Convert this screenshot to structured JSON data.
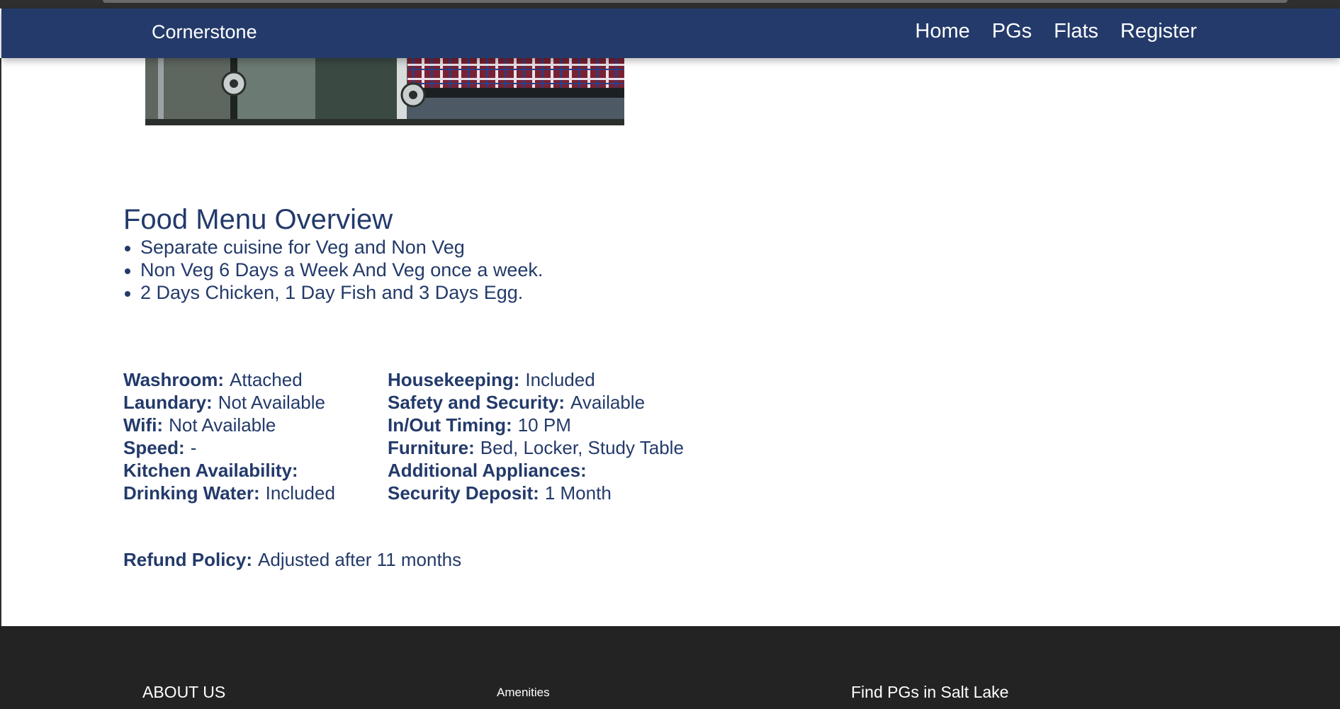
{
  "navbar": {
    "brand": "Cornerstone",
    "links": [
      "Home",
      "PGs",
      "Flats",
      "Register"
    ],
    "background": "#233a6a"
  },
  "hero_image": {
    "description_icon": "room-photo"
  },
  "food_menu": {
    "title": "Food Menu Overview",
    "items": [
      "Separate cuisine for Veg and Non Veg",
      "Non Veg 6 Days a Week And Veg once a week.",
      "2 Days Chicken, 1 Day Fish and 3 Days Egg."
    ]
  },
  "amenities": {
    "left": [
      {
        "label": "Washroom:",
        "value": "Attached"
      },
      {
        "label": "Laundary:",
        "value": "Not Available"
      },
      {
        "label": "Wifi:",
        "value": "Not Available"
      },
      {
        "label": "Speed:",
        "value": "-"
      },
      {
        "label": "Kitchen Availability:",
        "value": ""
      },
      {
        "label": "Drinking Water:",
        "value": "Included"
      }
    ],
    "right": [
      {
        "label": "Housekeeping:",
        "value": "Included"
      },
      {
        "label": "Safety and Security:",
        "value": "Available"
      },
      {
        "label": "In/Out Timing:",
        "value": "10 PM"
      },
      {
        "label": "Furniture:",
        "value": "Bed, Locker, Study Table"
      },
      {
        "label": "Additional Appliances:",
        "value": ""
      },
      {
        "label": "Security Deposit:",
        "value": "1 Month"
      }
    ]
  },
  "refund": {
    "label": "Refund Policy:",
    "value": "Adjusted after 11 months"
  },
  "footer": {
    "about": "ABOUT US",
    "amenities": "Amenities",
    "find": "Find PGs in Salt Lake",
    "background": "#232323"
  },
  "colors": {
    "text": "#233a6a",
    "page_background": "#ffffff"
  }
}
